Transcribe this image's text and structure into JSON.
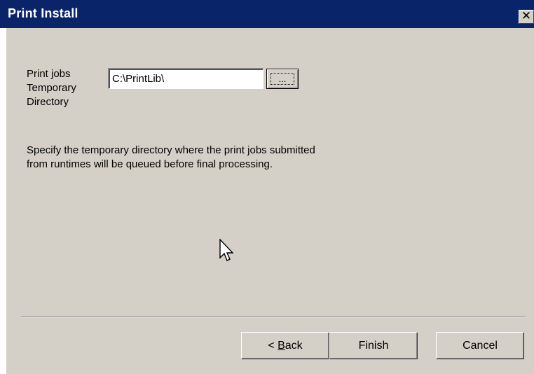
{
  "window": {
    "title": "Print Install",
    "close_label": "✕"
  },
  "form": {
    "field_label": "Print jobs\nTemporary\nDirectory",
    "path_value": "C:\\PrintLib\\",
    "browse_label": "...",
    "description": "Specify the temporary directory where the print jobs submitted from runtimes will be queued before final processing."
  },
  "buttons": {
    "back_prefix": "< ",
    "back_mnemonic": "B",
    "back_rest": "ack",
    "finish_label": "Finish",
    "cancel_label": "Cancel"
  },
  "colors": {
    "titlebar": "#0a246a",
    "face": "#d4d0c8"
  }
}
